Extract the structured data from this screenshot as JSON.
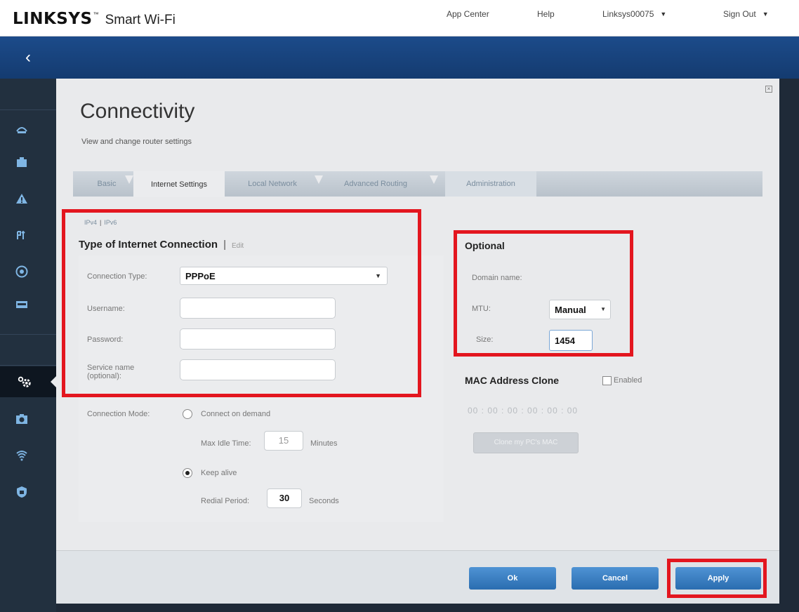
{
  "header": {
    "brand": "LINKSYS",
    "brand_mark": "™",
    "brand_sub": "Smart Wi-Fi",
    "nav": {
      "app_center": "App Center",
      "help": "Help",
      "router_name": "Linksys00075",
      "sign_out": "Sign Out"
    }
  },
  "sidebar": {
    "back": "‹",
    "icons": [
      "network-map-icon",
      "router-icon",
      "alert-icon",
      "speed-test-icon",
      "parental-icon",
      "device-icon",
      "settings-icon",
      "camera-icon",
      "wifi-icon",
      "security-icon"
    ]
  },
  "page": {
    "title": "Connectivity",
    "subtitle": "View and change router settings",
    "tabs": [
      "Basic",
      "Internet Settings",
      "Local Network",
      "Advanced Routing",
      "Administration"
    ],
    "active_tab": "Internet Settings"
  },
  "internet": {
    "ipv4": "IPv4",
    "ipv_sep": "|",
    "ipv6": "IPv6",
    "heading": "Type of Internet Connection",
    "heading_sep": "|",
    "edit": "Edit",
    "connection_type_label": "Connection Type:",
    "connection_type_value": "PPPoE",
    "username_label": "Username:",
    "username_value": "",
    "password_label": "Password:",
    "password_value": "",
    "service_name_label": "Service name (optional):",
    "service_name_value": "",
    "connection_mode_label": "Connection Mode:",
    "connect_on_demand": "Connect on demand",
    "max_idle_label": "Max Idle Time:",
    "max_idle_value": "15",
    "minutes": "Minutes",
    "keep_alive": "Keep alive",
    "redial_label": "Redial Period:",
    "redial_value": "30",
    "seconds": "Seconds"
  },
  "optional": {
    "heading": "Optional",
    "domain_label": "Domain name:",
    "mtu_label": "MTU:",
    "mtu_value": "Manual",
    "size_label": "Size:",
    "size_value": "1454"
  },
  "mac": {
    "heading": "MAC Address Clone",
    "enabled_label": "Enabled",
    "address": "00 : 00 : 00 : 00 : 00 : 00",
    "clone_button": "Clone my PC's MAC"
  },
  "footer": {
    "ok": "Ok",
    "cancel": "Cancel",
    "apply": "Apply"
  },
  "colors": {
    "highlight": "#e3161f",
    "banner": "#1c4b8a",
    "button": "#2a6db0"
  }
}
